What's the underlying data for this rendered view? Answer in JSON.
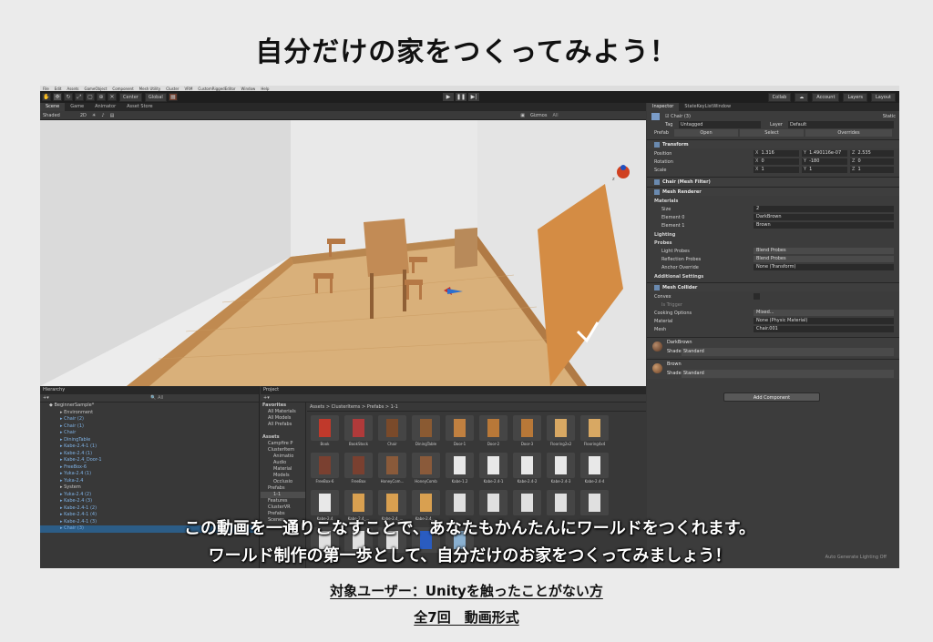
{
  "title": "自分だけの家をつくってみよう！",
  "footer": {
    "target": "対象ユーザー：Unityを触ったことがない方",
    "episodes": "全7回　動画形式"
  },
  "subtitles": [
    "この動画を一通りこなすことで、あなたもかんたんにワールドをつくれます。",
    "ワールド制作の第一歩として、自分だけのお家をつくってみましょう！"
  ],
  "editor": {
    "menu": [
      "File",
      "Edit",
      "Assets",
      "GameObject",
      "Component",
      "Mesh Utility",
      "Cluster",
      "VRM",
      "CustomRiggedEditor",
      "Window",
      "Help"
    ],
    "toolbar": {
      "center": "Center",
      "global": "Global",
      "collab": "Collab",
      "account": "Account",
      "layers": "Layers",
      "layout": "Layout"
    },
    "scene_tabs": [
      "Scene",
      "Game",
      "Animator",
      "Asset Store"
    ],
    "scene_bar": {
      "shading": "Shaded",
      "mode": "2D",
      "gizmos": "Gizmos",
      "search": "All"
    },
    "inspector": {
      "tabs": [
        "Inspector",
        "StateKeyListWindow"
      ],
      "object_name": "Chair (3)",
      "static": "Static",
      "tag_label": "Tag",
      "tag": "Untagged",
      "layer_label": "Layer",
      "layer": "Default",
      "prefab_label": "Prefab",
      "prefab_buttons": [
        "Open",
        "Select",
        "Overrides"
      ],
      "transform": {
        "header": "Transform",
        "position_label": "Position",
        "rotation_label": "Rotation",
        "scale_label": "Scale",
        "position": [
          "1.316",
          "1.490116e-07",
          "2.535"
        ],
        "rotation": [
          "0",
          "-180",
          "0"
        ],
        "scale": [
          "1",
          "1",
          "1"
        ]
      },
      "mesh_filter": "Chair (Mesh Filter)",
      "mesh_renderer": {
        "header": "Mesh Renderer",
        "materials": "Materials",
        "size_label": "Size",
        "size": "2",
        "element0_label": "Element 0",
        "element0": "DarkBrown",
        "element1_label": "Element 1",
        "element1": "Brown",
        "lighting": "Lighting",
        "probes": "Probes",
        "light_probes_label": "Light Probes",
        "light_probes": "Blend Probes",
        "reflection_probes_label": "Reflection Probes",
        "reflection_probes": "Blend Probes",
        "anchor_label": "Anchor Override",
        "anchor": "None (Transform)",
        "additional": "Additional Settings"
      },
      "mesh_collider": {
        "header": "Mesh Collider",
        "convex": "Convex",
        "is_trigger": "Is Trigger",
        "cooking_label": "Cooking Options",
        "cooking": "Mixed...",
        "material_label": "Material",
        "material": "None (Physic Material)",
        "mesh_label": "Mesh",
        "mesh": "Chair.001"
      },
      "materials_list": [
        {
          "name": "DarkBrown",
          "shader_label": "Shader",
          "shader": "Standard"
        },
        {
          "name": "Brown",
          "shader_label": "Shader",
          "shader": "Standard"
        }
      ],
      "add_component": "Add Component"
    },
    "hierarchy": {
      "tab": "Hierarchy",
      "search": "All",
      "items": [
        {
          "label": "BeginnerSample*",
          "indent": 0,
          "type": "scene"
        },
        {
          "label": "Environment",
          "indent": 1,
          "type": "plain"
        },
        {
          "label": "Chair (2)",
          "indent": 1,
          "type": "blue"
        },
        {
          "label": "Chair (1)",
          "indent": 1,
          "type": "blue"
        },
        {
          "label": "Chair",
          "indent": 1,
          "type": "blue"
        },
        {
          "label": "DiningTable",
          "indent": 1,
          "type": "blue"
        },
        {
          "label": "Kabe-2.4-1 (1)",
          "indent": 1,
          "type": "blue"
        },
        {
          "label": "Kabe-2.4 (1)",
          "indent": 1,
          "type": "blue"
        },
        {
          "label": "Kabe-2.4_Door-1",
          "indent": 1,
          "type": "blue"
        },
        {
          "label": "FreeBox-6",
          "indent": 1,
          "type": "blue"
        },
        {
          "label": "Yuka-2.4 (1)",
          "indent": 1,
          "type": "blue"
        },
        {
          "label": "Yuka-2.4",
          "indent": 1,
          "type": "blue"
        },
        {
          "label": "System",
          "indent": 1,
          "type": "plain"
        },
        {
          "label": "Yuka-2.4 (2)",
          "indent": 1,
          "type": "blue"
        },
        {
          "label": "Kabe-2.4 (3)",
          "indent": 1,
          "type": "blue"
        },
        {
          "label": "Kabe-2.4-1 (2)",
          "indent": 1,
          "type": "blue"
        },
        {
          "label": "Kabe-2.4-1 (4)",
          "indent": 1,
          "type": "blue"
        },
        {
          "label": "Kabe-2.4-1 (3)",
          "indent": 1,
          "type": "blue"
        },
        {
          "label": "Chair (3)",
          "indent": 1,
          "type": "selected"
        }
      ]
    },
    "project": {
      "tab": "Project",
      "breadcrumb": "Assets > ClusterItems > Prefabs > 1-1",
      "tree": [
        "Favorites",
        "All Materials",
        "All Models",
        "All Prefabs",
        "",
        "Assets",
        "Campfire P",
        "ClusterItem",
        "Animatio",
        "Audio",
        "Material",
        "Models",
        "Occlusio",
        "Prefabs",
        "1-1",
        "Features",
        "ClusterVR",
        "Prefabs",
        "Scenes"
      ],
      "assets": [
        {
          "label": "Book",
          "color": "#c0392b"
        },
        {
          "label": "BookStock",
          "color": "#b03a3a"
        },
        {
          "label": "Chair",
          "color": "#7a4a2a"
        },
        {
          "label": "DiningTable",
          "color": "#8a5a32"
        },
        {
          "label": "Door-1",
          "color": "#c08040"
        },
        {
          "label": "Door-2",
          "color": "#b87838"
        },
        {
          "label": "Door-3",
          "color": "#b87838"
        },
        {
          "label": "Flooring2x2",
          "color": "#d8a863"
        },
        {
          "label": "Flooring4x4",
          "color": "#d8a863"
        },
        {
          "label": "FreeBox-6",
          "color": "#7a4030"
        },
        {
          "label": "FreeBox",
          "color": "#7a4030"
        },
        {
          "label": "HoneyCom...",
          "color": "#8a5a3a"
        },
        {
          "label": "HoneyComb",
          "color": "#8a5a3a"
        },
        {
          "label": "Kabe-1.2",
          "color": "#e8e8e8"
        },
        {
          "label": "Kabe-2.4-1",
          "color": "#e8e8e8"
        },
        {
          "label": "Kabe-2.4-2",
          "color": "#e8e8e8"
        },
        {
          "label": "Kabe-2.4-3",
          "color": "#e8e8e8"
        },
        {
          "label": "Kabe-2.4-4",
          "color": "#e8e8e8"
        },
        {
          "label": "Kabe-2.4",
          "color": "#e8e8e8"
        },
        {
          "label": "Kabe-2.4_...",
          "color": "#d9a050"
        },
        {
          "label": "Kabe-2.4_...",
          "color": "#d9a050"
        },
        {
          "label": "Kabe-2.4_...",
          "color": "#d9a050"
        },
        {
          "label": "",
          "color": "#e0e0e0"
        },
        {
          "label": "",
          "color": "#e0e0e0"
        },
        {
          "label": "",
          "color": "#e0e0e0"
        },
        {
          "label": "",
          "color": "#e0e0e0"
        },
        {
          "label": "",
          "color": "#e0e0e0"
        },
        {
          "label": "",
          "color": "#e0e0e0"
        },
        {
          "label": "",
          "color": "#e0e0e0"
        },
        {
          "label": "",
          "color": "#e0e0e0"
        },
        {
          "label": "",
          "color": "#2a5cc0"
        },
        {
          "label": "",
          "color": "#8ab0d0"
        }
      ]
    },
    "status": "Auto Generate Lighting Off"
  }
}
